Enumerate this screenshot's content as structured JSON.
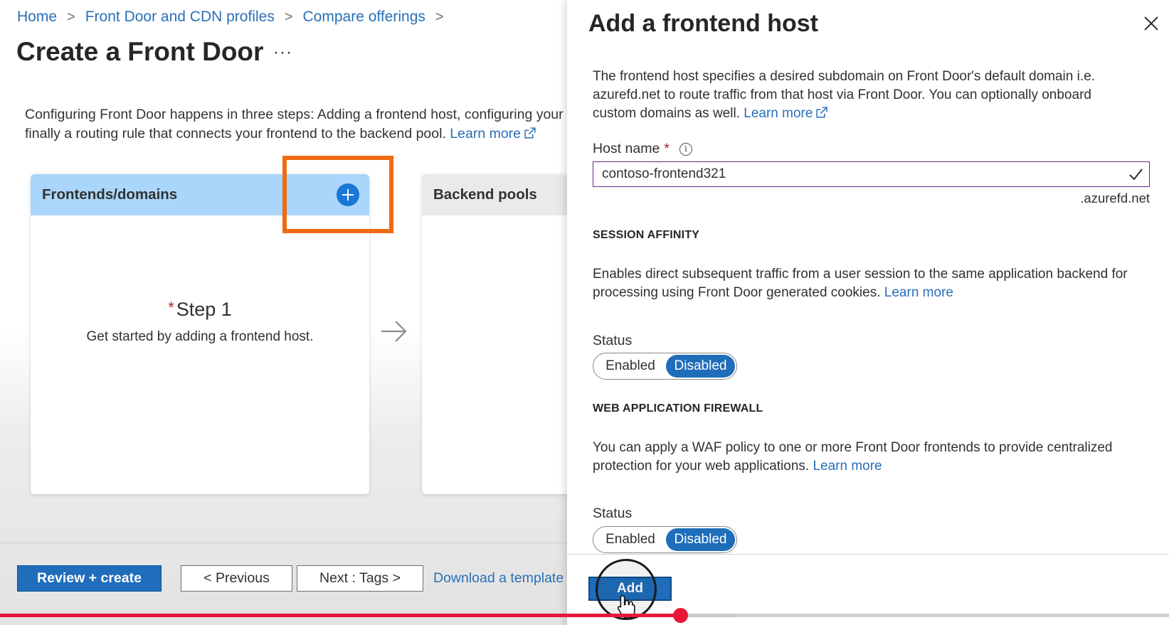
{
  "breadcrumb": {
    "items": [
      "Home",
      "Front Door and CDN profiles",
      "Compare offerings"
    ]
  },
  "page": {
    "title": "Create a Front Door",
    "more_label": "···",
    "intro_line1": "Configuring Front Door happens in three steps: Adding a frontend host, configuring your",
    "intro_line2": "finally a routing rule that connects your frontend to the backend pool.",
    "intro_link": "Learn more"
  },
  "cards": {
    "frontends": {
      "title": "Frontends/domains",
      "step_title": "Step 1",
      "step_desc": "Get started by adding a frontend host."
    },
    "backends": {
      "title": "Backend pools"
    }
  },
  "footer": {
    "review_create": "Review + create",
    "previous": "< Previous",
    "next": "Next : Tags >",
    "download": "Download a template"
  },
  "panel": {
    "title": "Add a frontend host",
    "intro_line1": "The frontend host specifies a desired subdomain on Front Door's default domain i.e.",
    "intro_line2": "azurefd.net to route traffic from that host via Front Door. You can optionally onboard",
    "intro_line3": "custom domains as well.",
    "intro_link": "Learn more",
    "host_name": {
      "label": "Host name",
      "required_mark": "*",
      "value": "contoso-frontend321",
      "suffix": ".azurefd.net"
    },
    "session_affinity": {
      "title": "SESSION AFFINITY",
      "desc_line1": "Enables direct subsequent traffic from a user session to the same application backend for",
      "desc_line2": "processing using Front Door generated cookies.",
      "link": "Learn more",
      "status_label": "Status",
      "enabled": "Enabled",
      "disabled": "Disabled",
      "selected": "Disabled"
    },
    "waf": {
      "title": "WEB APPLICATION FIREWALL",
      "desc_line1": "You can apply a WAF policy to one or more Front Door frontends to provide centralized",
      "desc_line2": "protection for your web applications.",
      "link": "Learn more",
      "status_label": "Status",
      "enabled": "Enabled",
      "disabled": "Disabled",
      "selected": "Disabled"
    },
    "add_button": "Add"
  },
  "video": {
    "played_fraction": 0.582,
    "buffered_fraction": 0.63
  },
  "colors": {
    "accent": "#1f6dbb",
    "link": "#2a6fb8",
    "highlight": "#f06a11",
    "progress": "#e8173a"
  },
  "icons": {
    "add_frontend": "plus-circle-icon",
    "close": "close-icon",
    "external_link": "external-link-icon",
    "info": "info-icon",
    "check": "check-icon",
    "arrow": "arrow-right-icon",
    "cursor": "hand-pointer-icon"
  }
}
